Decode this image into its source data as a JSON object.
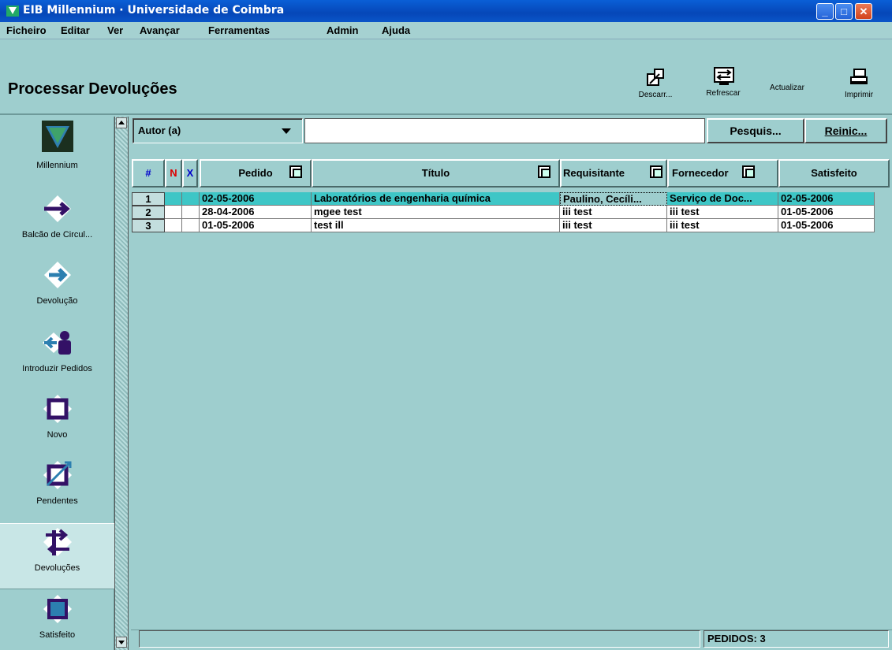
{
  "window": {
    "title": "EIB Millennium · Universidade de Coimbra",
    "minimize": "_",
    "maximize": "□",
    "close": "✕"
  },
  "menu": [
    "Ficheiro",
    "Editar",
    "Ver",
    "Avançar",
    "Ferramentas",
    "Admin",
    "Ajuda"
  ],
  "header": {
    "title": "Processar Devoluções",
    "tools": {
      "discard": "Descarr...",
      "refresh": "Refrescar",
      "update": "Actualizar",
      "print": "Imprimir"
    }
  },
  "sidebar": {
    "items": [
      {
        "label": "Millennium",
        "icon": "millennium-logo-icon"
      },
      {
        "label": "Balcão de Circul...",
        "icon": "arrow-right-icon"
      },
      {
        "label": "Devolução",
        "icon": "return-arrow-icon"
      },
      {
        "label": "Introduzir Pedidos",
        "icon": "person-arrow-icon"
      },
      {
        "label": "Novo",
        "icon": "new-square-icon"
      },
      {
        "label": "Pendentes",
        "icon": "pending-square-icon"
      },
      {
        "label": "Devoluções",
        "icon": "returns-arrows-icon"
      },
      {
        "label": "Satisfeito",
        "icon": "satisfied-square-icon"
      }
    ]
  },
  "search": {
    "field": "Autor (a)",
    "value": "",
    "search_button": "Pesquis...",
    "reset_button": "Reinic..."
  },
  "table": {
    "headers": {
      "index": "#",
      "n": "N",
      "x": "X",
      "pedido": "Pedido",
      "titulo": "Título",
      "requisitante": "Requisitante",
      "fornecedor": "Fornecedor",
      "satisfeito": "Satisfeito"
    },
    "rows": [
      {
        "index": "1",
        "pedido": "02-05-2006",
        "titulo": "Laboratórios de engenharia química",
        "requisitante": "Paulino, Cecíli...",
        "fornecedor": "Serviço de Doc...",
        "satisfeito": "02-05-2006"
      },
      {
        "index": "2",
        "pedido": "28-04-2006",
        "titulo": "mgee test",
        "requisitante": "iii test",
        "fornecedor": "iii test",
        "satisfeito": "01-05-2006"
      },
      {
        "index": "3",
        "pedido": "01-05-2006",
        "titulo": "test ill",
        "requisitante": "iii test",
        "fornecedor": "iii test",
        "satisfeito": "01-05-2006"
      }
    ]
  },
  "status": {
    "message": "",
    "count": "PEDIDOS: 3"
  },
  "colors": {
    "background": "#9ecece",
    "selected_row": "#3ec6c6",
    "titlebar": "#0a5fd6",
    "n_marker": "#dd0000",
    "x_marker": "#0000cc"
  }
}
